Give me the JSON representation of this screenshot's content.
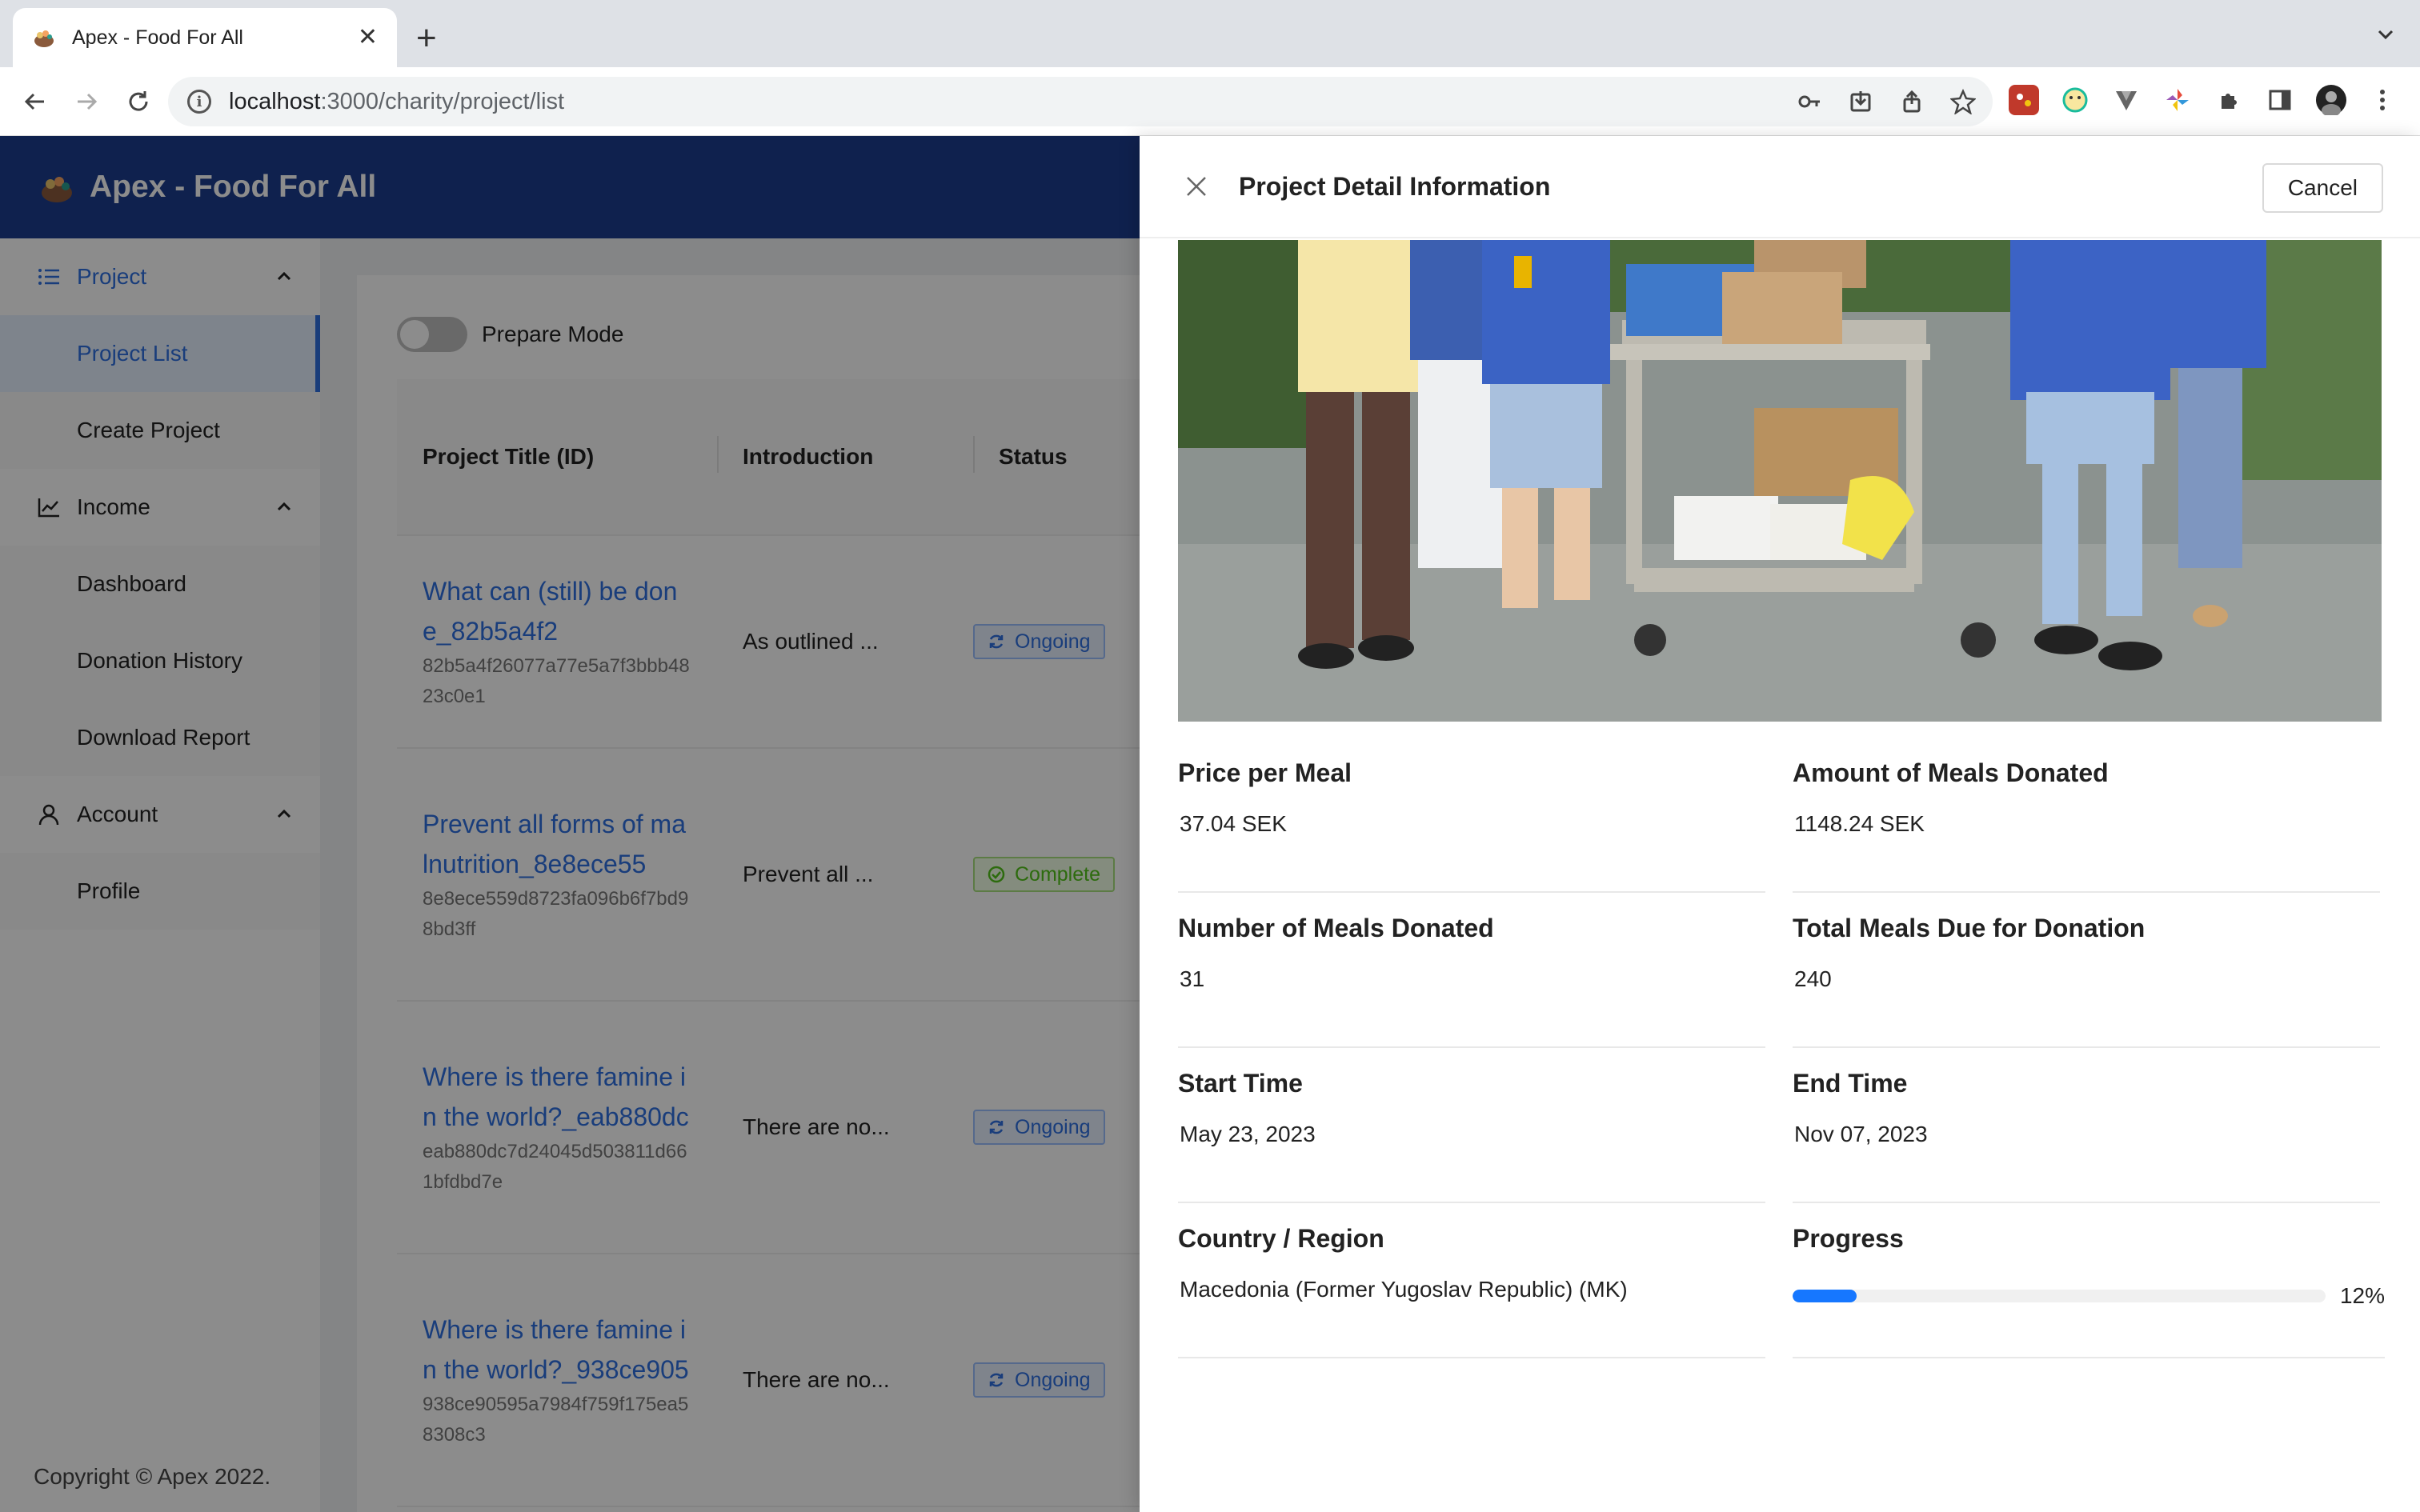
{
  "browser": {
    "tab_title": "Apex - Food For All",
    "url_host": "localhost",
    "url_path": ":3000/charity/project/list"
  },
  "app": {
    "title": "Apex - Food For All",
    "copyright": "Copyright © Apex 2022."
  },
  "sidebar": {
    "groups": [
      {
        "label": "Project",
        "icon": "list-icon",
        "items": [
          "Project List",
          "Create Project"
        ]
      },
      {
        "label": "Income",
        "icon": "line-chart-icon",
        "items": [
          "Dashboard",
          "Donation History",
          "Download Report"
        ]
      },
      {
        "label": "Account",
        "icon": "user-icon",
        "items": [
          "Profile"
        ]
      }
    ],
    "selected_item": "Project List"
  },
  "main": {
    "prepare_mode_label": "Prepare Mode",
    "prepare_mode_on": false,
    "columns": [
      "Project Title (ID)",
      "Introduction",
      "Status"
    ],
    "rows": [
      {
        "title": "What can (still) be done_82b5a4f2",
        "id": "82b5a4f26077a77e5a7f3bbb4823c0e1",
        "intro": "As outlined ...",
        "status": "Ongoing"
      },
      {
        "title": "Prevent all forms of malnutrition_8e8ece55",
        "id": "8e8ece559d8723fa096b6f7bd98bd3ff",
        "intro": "Prevent all ...",
        "status": "Complete"
      },
      {
        "title": "Where is there famine in the world?_eab880dc",
        "id": "eab880dc7d24045d503811d661bfdbd7e",
        "intro": "There are no...",
        "status": "Ongoing"
      },
      {
        "title": "Where is there famine in the world?_938ce905",
        "id": "938ce90595a7984f759f175ea58308c3",
        "intro": "There are no...",
        "status": "Ongoing"
      }
    ]
  },
  "drawer": {
    "title": "Project Detail Information",
    "cancel_label": "Cancel",
    "fields": {
      "price_per_meal_label": "Price per Meal",
      "price_per_meal": "37.04 SEK",
      "amount_donated_label": "Amount of Meals Donated",
      "amount_donated": "1148.24 SEK",
      "num_meals_label": "Number of Meals Donated",
      "num_meals": "31",
      "total_due_label": "Total Meals Due for Donation",
      "total_due": "240",
      "start_label": "Start Time",
      "start": "May 23, 2023",
      "end_label": "End Time",
      "end": "Nov 07, 2023",
      "country_label": "Country / Region",
      "country": "Macedonia (Former Yugoslav Republic) (MK)",
      "progress_label": "Progress",
      "progress_text": "12%",
      "progress_value": 0.12
    }
  },
  "colors": {
    "header": "#1d3d8f",
    "accent": "#2f6fe0",
    "progress": "#1677ff",
    "complete": "#52c41a"
  }
}
